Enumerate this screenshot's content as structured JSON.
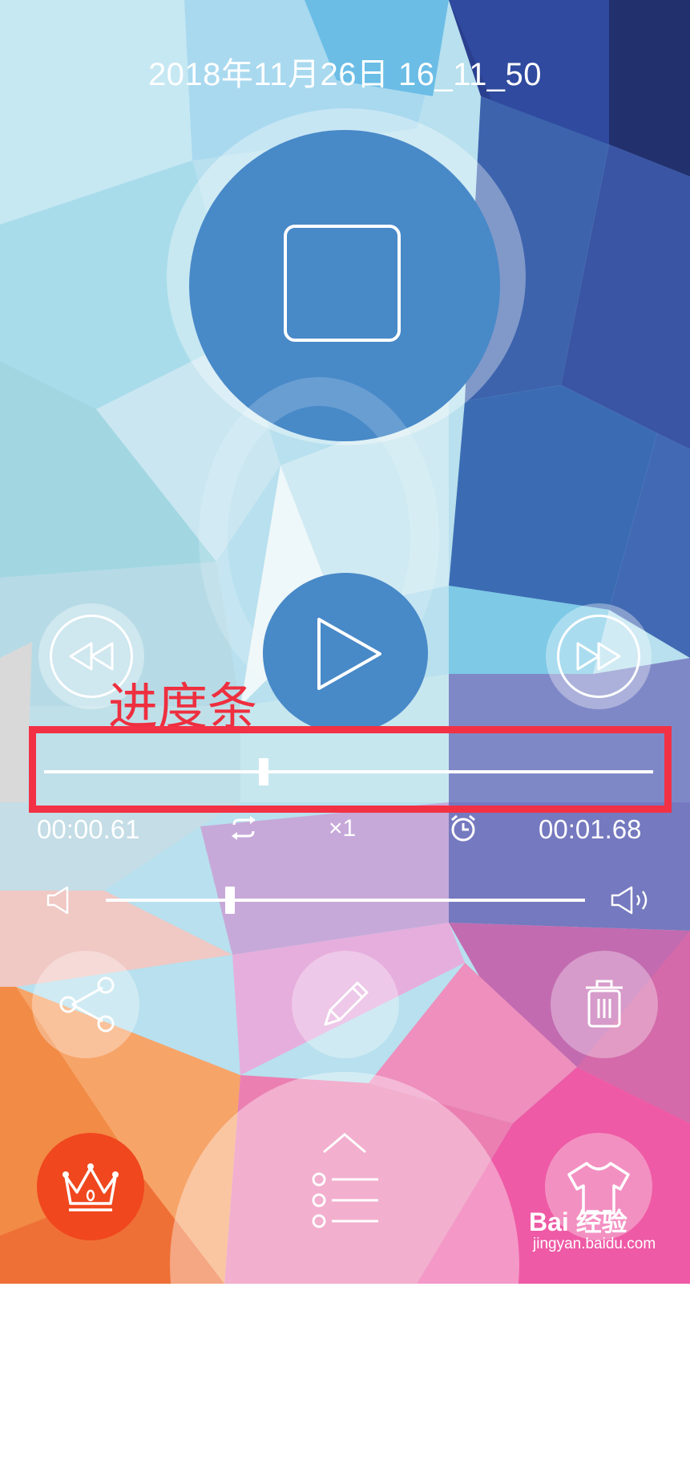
{
  "title": "2018年11月26日 16_11_50",
  "annotation": {
    "label": "进度条",
    "color": "#f33145"
  },
  "progress": {
    "current_time": "00:00.61",
    "total_time": "00:01.68",
    "position_fraction": 0.36
  },
  "playback": {
    "speed_label": "×1",
    "loop_icon": "repeat-icon",
    "timer_icon": "alarm-clock-icon"
  },
  "volume": {
    "level_fraction": 0.26
  },
  "icons": {
    "record_stop": "stop-icon",
    "play": "play-icon",
    "rewind": "rewind-icon",
    "fast_forward": "fast-forward-icon",
    "share": "share-icon",
    "edit": "pencil-icon",
    "delete": "trash-icon",
    "vip": "crown-icon",
    "list": "list-icon",
    "skin": "tshirt-icon"
  },
  "watermark": {
    "main": "Bai 经验",
    "sub": "jingyan.baidu.com"
  },
  "colors": {
    "accent_blue": "#4889c8",
    "vip_orange": "#f0471e"
  }
}
